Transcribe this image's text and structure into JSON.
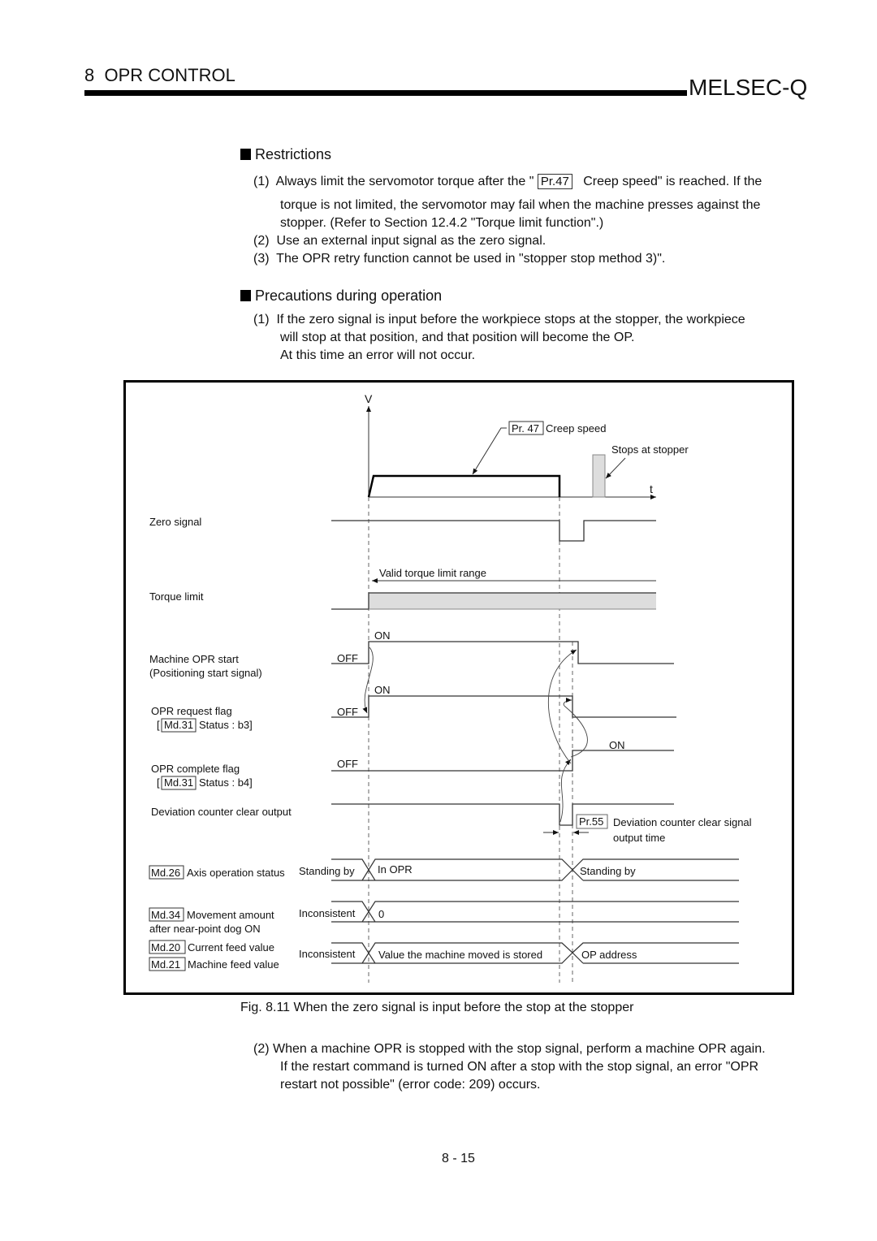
{
  "header": {
    "chapter_number": "8",
    "chapter_title": "OPR CONTROL",
    "brand": "MELSEC-Q"
  },
  "restrictions": {
    "title": "Restrictions",
    "items": [
      {
        "num": "(1)",
        "line1_pre": "Always limit the servomotor torque after the \"",
        "param": "Pr.47",
        "line1_post": "Creep speed\" is reached. If the",
        "line2": "torque is not limited, the servomotor may fail when the machine presses against the",
        "line3": "stopper. (Refer to Section 12.4.2 \"Torque limit function\".)"
      },
      {
        "num": "(2)",
        "text": "Use an external input signal as the zero signal."
      },
      {
        "num": "(3)",
        "text": "The OPR retry function cannot be used in \"stopper stop method 3)\"."
      }
    ]
  },
  "precautions": {
    "title": "Precautions during operation",
    "items": [
      {
        "num": "(1)",
        "line1": "If the zero signal is input before the workpiece stops at the stopper, the workpiece",
        "line2": "will stop at that position, and that position will become the OP.",
        "line3": "At this time an error will not occur."
      },
      {
        "num": "(2)",
        "line1": "When a machine OPR is stopped with the stop signal, perform a machine OPR again.",
        "line2": "If the restart command is turned ON after a stop with the stop signal, an error \"OPR",
        "line3": "restart not possible\" (error code: 209) occurs."
      }
    ]
  },
  "figure": {
    "caption": "Fig. 8.11 When the zero signal is input before the stop at the stopper",
    "axis_v": "V",
    "axis_t": "t",
    "creep_param": "Pr. 47",
    "creep_label": "Creep speed",
    "stopper_label": "Stops at stopper",
    "valid_torque_label": "Valid torque limit range",
    "on_label": "ON",
    "off_label": "OFF",
    "signals": {
      "zero_signal": "Zero signal",
      "torque_limit": "Torque limit",
      "opr_start_1": "Machine OPR start",
      "opr_start_2": "(Positioning start signal)",
      "opr_request_1": "OPR request flag",
      "opr_request_param": "Md.31",
      "opr_request_status": "Status : b3]",
      "opr_complete_1": "OPR complete flag",
      "opr_complete_param": "Md.31",
      "opr_complete_status": "Status : b4]",
      "dev_clear": "Deviation counter clear output",
      "dev_param": "Pr.55",
      "dev_note_1": "Deviation counter clear signal",
      "dev_note_2": "output time"
    },
    "monitors": {
      "axis_param": "Md.26",
      "axis_label": "Axis operation status",
      "axis_values": [
        "Standing by",
        "In OPR",
        "Standing by"
      ],
      "move_param": "Md.34",
      "move_label_1": "Movement amount",
      "move_label_2": "after near-point dog ON",
      "move_values": [
        "Inconsistent",
        "0"
      ],
      "feed_param_1": "Md.20",
      "feed_label_1": "Current feed value",
      "feed_param_2": "Md.21",
      "feed_label_2": "Machine feed value",
      "feed_values": [
        "Inconsistent",
        "Value the machine moved is stored",
        "OP address"
      ]
    }
  },
  "page_number": "8 - 15"
}
